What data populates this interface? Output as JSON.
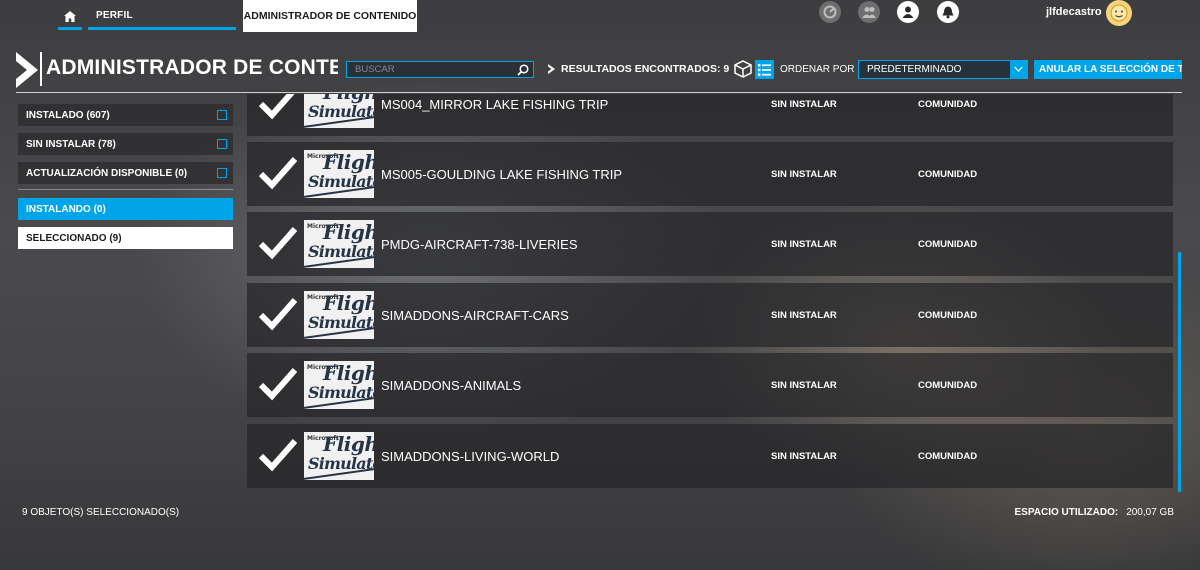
{
  "topbar": {
    "home_icon": "home-icon",
    "tabs": [
      {
        "label": "PERFIL"
      },
      {
        "label": "ADMINISTRADOR DE CONTENIDO"
      }
    ],
    "icons": [
      "performance-icon",
      "friends-icon",
      "profile-icon",
      "notifications-icon"
    ],
    "username": "jlfdecastro",
    "accent_color": "#00a4e8"
  },
  "header": {
    "title": "ADMINISTRADOR DE CONTENIDO",
    "search_placeholder": "BUSCAR",
    "results_label": "RESULTADOS ENCONTRADOS: 9",
    "sort_label": "ORDENAR POR",
    "sort_value": "PREDETERMINADO",
    "clear_selection_label": "ANULAR LA SELECCIÓN DE TODO"
  },
  "sidebar": {
    "filters": [
      {
        "label": "INSTALADO (607)",
        "checked": false
      },
      {
        "label": "SIN INSTALAR (78)",
        "checked": false
      },
      {
        "label": "ACTUALIZACIÓN DISPONIBLE (0)",
        "checked": false
      }
    ],
    "groups": [
      {
        "label": "INSTALANDO (0)",
        "state": "active"
      },
      {
        "label": "SELECCIONADO (9)",
        "state": "highlighted"
      }
    ]
  },
  "list": {
    "rows": [
      {
        "name": "MS004_MIRROR LAKE FISHING TRIP",
        "status": "SIN INSTALAR",
        "source": "COMUNIDAD",
        "selected": true
      },
      {
        "name": "MS005-GOULDING LAKE FISHING TRIP",
        "status": "SIN INSTALAR",
        "source": "COMUNIDAD",
        "selected": true
      },
      {
        "name": "PMDG-AIRCRAFT-738-LIVERIES",
        "status": "SIN INSTALAR",
        "source": "COMUNIDAD",
        "selected": true
      },
      {
        "name": "SIMADDONS-AIRCRAFT-CARS",
        "status": "SIN INSTALAR",
        "source": "COMUNIDAD",
        "selected": true
      },
      {
        "name": "SIMADDONS-ANIMALS",
        "status": "SIN INSTALAR",
        "source": "COMUNIDAD",
        "selected": true
      },
      {
        "name": "SIMADDONS-LIVING-WORLD",
        "status": "SIN INSTALAR",
        "source": "COMUNIDAD",
        "selected": true
      }
    ],
    "logo": {
      "line1": "Microsoft",
      "line2": "Flight",
      "line3": "Simulator"
    }
  },
  "footer": {
    "selected_count": "9 OBJETO(S) SELECCIONADO(S)",
    "space_label": "ESPACIO UTILIZADO:",
    "space_value": "200,07 GB"
  }
}
